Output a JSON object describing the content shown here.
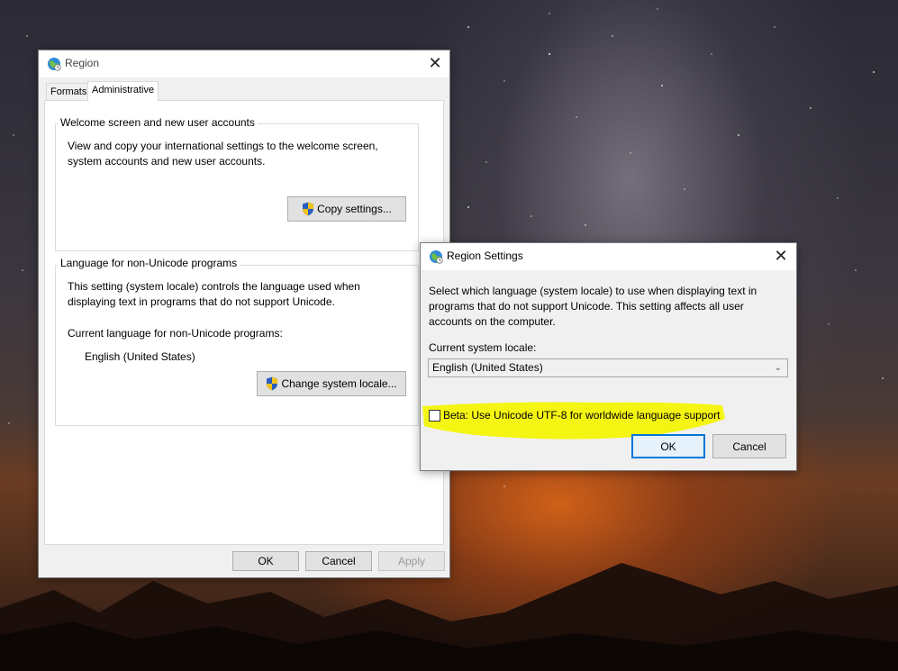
{
  "region_window": {
    "title": "Region",
    "tabs": [
      {
        "label": "Formats"
      },
      {
        "label": "Administrative"
      }
    ],
    "welcome_group": {
      "title": "Welcome screen and new user accounts",
      "description_line1": "View and copy your international settings to the welcome screen,",
      "description_line2": "system accounts and new user accounts.",
      "copy_button": "Copy settings..."
    },
    "unicode_group": {
      "title": "Language for non-Unicode programs",
      "description_line1": "This setting (system locale) controls the language used when",
      "description_line2": "displaying text in programs that do not support Unicode.",
      "current_label": "Current language for non-Unicode programs:",
      "current_value": "English (United States)",
      "change_button": "Change system locale..."
    },
    "buttons": {
      "ok": "OK",
      "cancel": "Cancel",
      "apply": "Apply"
    }
  },
  "region_settings_dialog": {
    "title": "Region Settings",
    "description_line1": "Select which language (system locale) to use when displaying text in",
    "description_line2": "programs that do not support Unicode. This setting affects all user",
    "description_line3": "accounts on the computer.",
    "locale_label": "Current system locale:",
    "locale_value": "English (United States)",
    "beta_checkbox_label": "Beta: Use Unicode UTF-8 for worldwide language support",
    "beta_checked": false,
    "buttons": {
      "ok": "OK",
      "cancel": "Cancel"
    }
  },
  "colors": {
    "highlight": "#f5f500",
    "accent_focus": "#0078d7"
  },
  "icons": {
    "window_icon": "globe-clock-icon",
    "uac": "uac-shield-icon",
    "close": "close-icon",
    "dropdown": "chevron-down-icon"
  }
}
